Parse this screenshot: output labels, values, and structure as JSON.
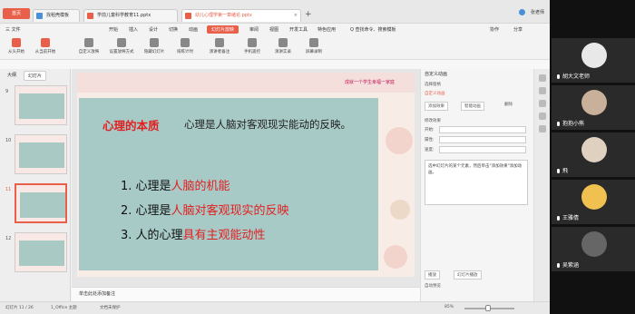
{
  "tabs": {
    "home": "首页",
    "tab1": "找稻壳模板",
    "tab2": "学前儿童科学教育11.pptx",
    "tab3": "幼儿心理学第一章绪论.pptx",
    "user": "张老师"
  },
  "menu": [
    "三 文件",
    "开始",
    "插入",
    "设计",
    "切换",
    "动画",
    "幻灯片放映",
    "审阅",
    "视图",
    "开发工具",
    "特色应用",
    "Q 查找命令、搜索模板"
  ],
  "menu_right": [
    "协作",
    "分享"
  ],
  "toolbar": [
    "从头开始",
    "从当前开始",
    "自定义放映",
    "设置放映方式",
    "隐藏幻灯片",
    "排练计时",
    "演讲者备注",
    "手机遥控",
    "演讲实录",
    "屏幕录制"
  ],
  "left_panel": {
    "tabs": [
      "大纲",
      "幻灯片"
    ],
    "numbers": [
      "9",
      "10",
      "11",
      "12"
    ]
  },
  "slide": {
    "top_note": "成就一个学生幸福一家庭",
    "heading": "心理的本质",
    "heading_text": "心理是人脑对客观现实能动的反映。",
    "lines": [
      {
        "prefix": "1. 心理是",
        "highlight": "人脑的机能"
      },
      {
        "prefix": "2. 心理是",
        "highlight": "人脑对客观现实的反映"
      },
      {
        "prefix": "3. 人的心理",
        "highlight": "具有主观能动性"
      }
    ]
  },
  "notes": "单击此处添加备注",
  "right_pane": {
    "title": "自定义动画",
    "r1": "选择窗格",
    "r2": "自定义动画",
    "r3": "添加效果",
    "r4": "智能动画",
    "r5": "删除",
    "sec": "修改效果",
    "f1": "开始:",
    "f2": "属性:",
    "f3": "速度:",
    "box": "选中幻灯片的某个元素，然后单击\"添加效果\"添加动画。",
    "play": "播放",
    "show": "幻灯片播放",
    "auto": "自动预览"
  },
  "status": {
    "page": "幻灯片 11 / 26",
    "theme": "1_Office 主题",
    "font": "文档未保护",
    "zoom": "85%"
  },
  "participants": [
    {
      "name": "胡大文老师",
      "color": "#e8e8e8"
    },
    {
      "name": "抱抱小熊",
      "color": "#c9b09a"
    },
    {
      "name": "飛",
      "color": "#e0d0c0"
    },
    {
      "name": "王雅倩",
      "color": "#f0c050"
    },
    {
      "name": "吴紫涵",
      "color": "#666666"
    }
  ]
}
